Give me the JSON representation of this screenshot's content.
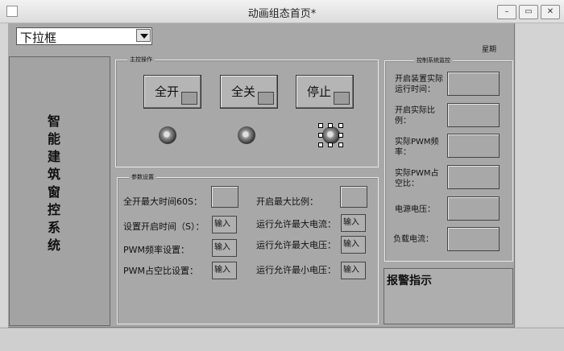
{
  "window": {
    "title": "动画组态首页*"
  },
  "dropdown": {
    "value": "下拉框"
  },
  "weekday_label": "星期",
  "system_title": [
    "智",
    "能",
    "建",
    "筑",
    "窗",
    "控",
    "系",
    "统"
  ],
  "main_ops": {
    "title": "主控操作",
    "buttons": [
      "全开",
      "全关",
      "停止"
    ]
  },
  "params": {
    "title": "参数设置",
    "left_labels": [
      "全开最大时间60S：",
      "设置开启时间（S）：",
      "PWM频率设置：",
      "PWM占空比设置："
    ],
    "right_labels": [
      "开启最大比例：",
      "运行允许最大电流：",
      "运行允许最大电压：",
      "运行允许最小电压："
    ],
    "input_placeholder": "输入框"
  },
  "monitor": {
    "title": "控制系统监控",
    "labels": [
      "开启装置实际运行时间：",
      "开启实际比例：",
      "实际PWM频率：",
      "实际PWM占空比：",
      "电源电压：",
      "负载电流："
    ]
  },
  "alarm": {
    "title": "报警指示"
  }
}
